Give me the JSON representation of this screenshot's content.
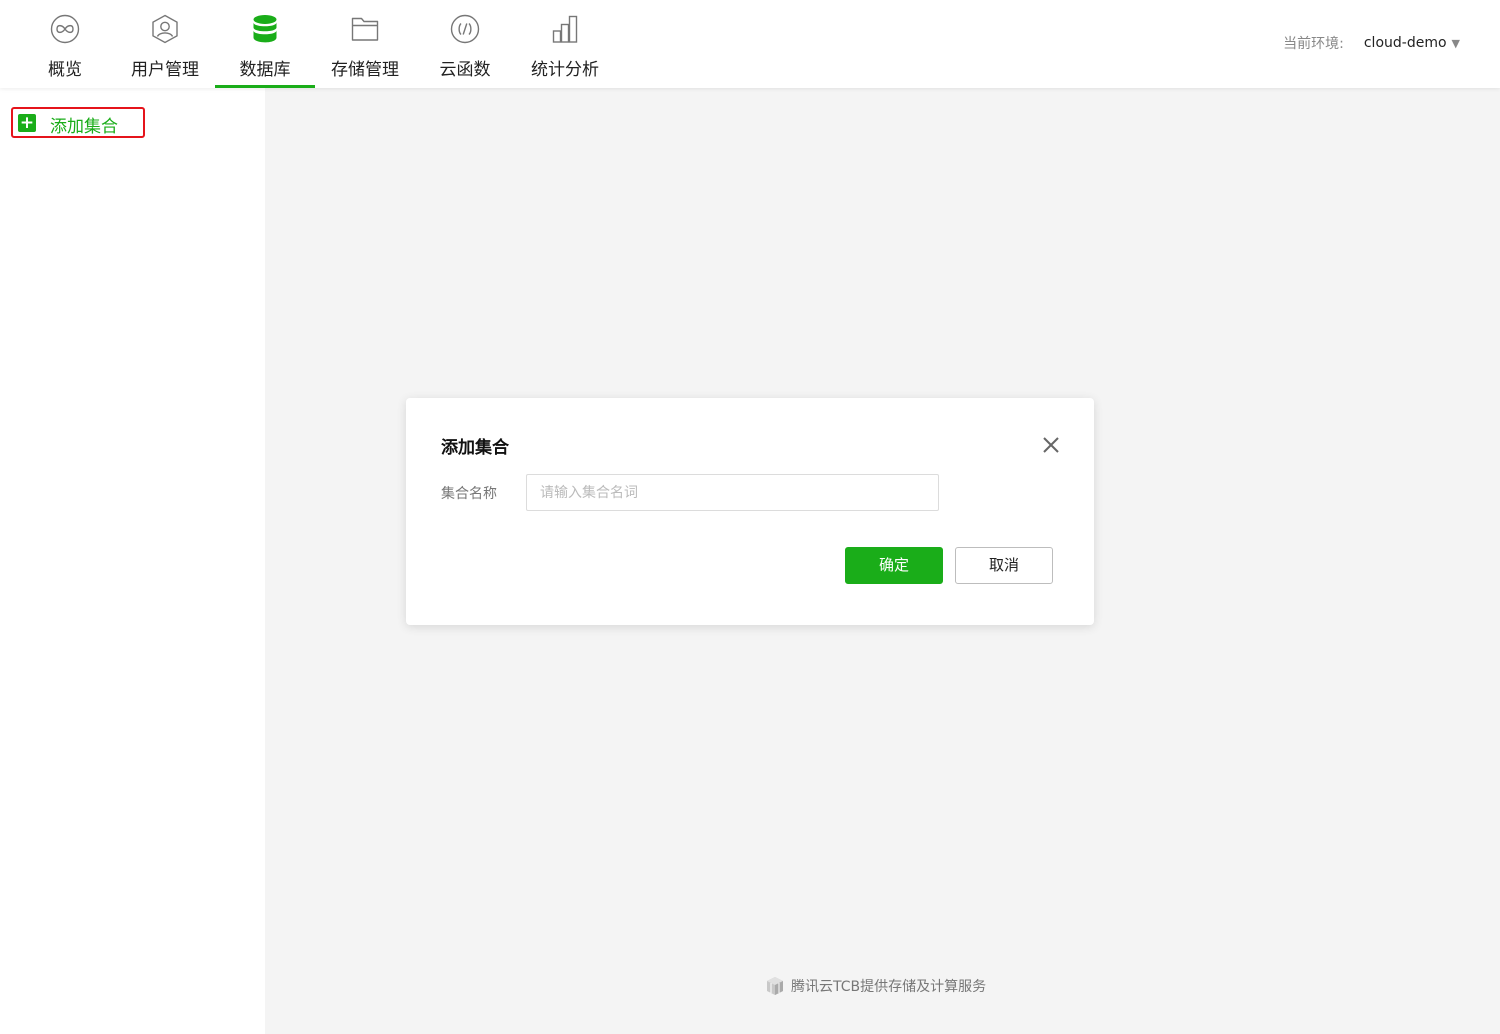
{
  "nav": {
    "items": [
      {
        "label": "概览",
        "icon": "infinity-icon"
      },
      {
        "label": "用户管理",
        "icon": "user-icon"
      },
      {
        "label": "数据库",
        "icon": "database-icon",
        "active": true
      },
      {
        "label": "存储管理",
        "icon": "folder-icon"
      },
      {
        "label": "云函数",
        "icon": "code-icon"
      },
      {
        "label": "统计分析",
        "icon": "bar-chart-icon"
      }
    ]
  },
  "env": {
    "label": "当前环境:",
    "value": "cloud-demo"
  },
  "sidebar": {
    "add_label": "添加集合"
  },
  "dialog": {
    "title": "添加集合",
    "field_label": "集合名称",
    "input_placeholder": "请输入集合名词",
    "input_value": "",
    "confirm_label": "确定",
    "cancel_label": "取消"
  },
  "footer": {
    "text": "腾讯云TCB提供存储及计算服务"
  },
  "colors": {
    "accent": "#1aad19",
    "highlight_border": "#e5141b",
    "background": "#f4f4f4"
  }
}
